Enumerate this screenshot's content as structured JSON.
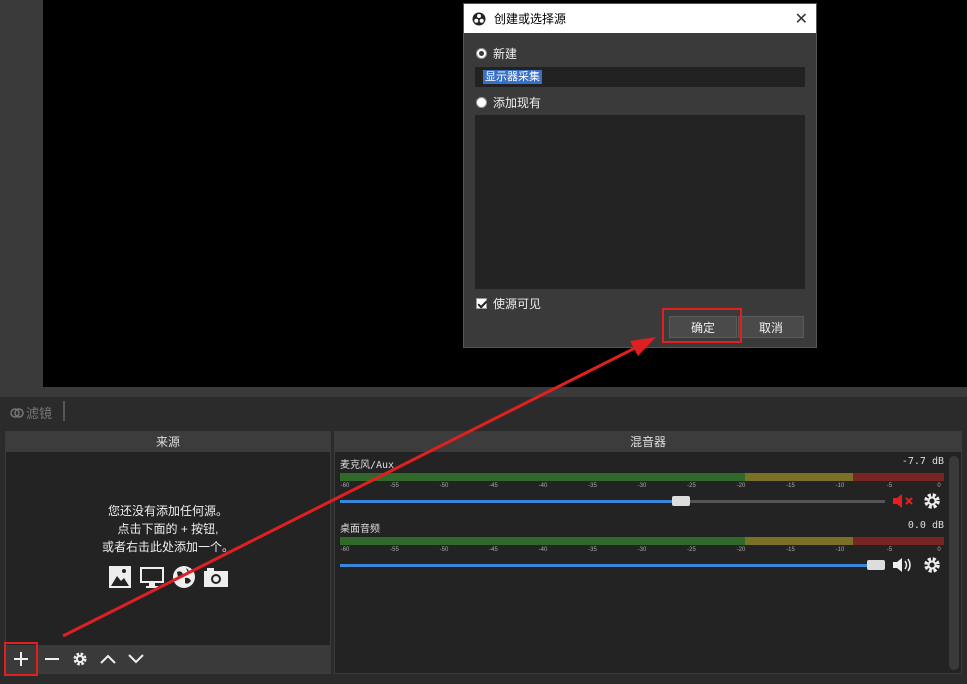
{
  "filters": {
    "label": "滤镜"
  },
  "sources": {
    "title": "来源",
    "empty_line1": "您还没有添加任何源。",
    "empty_line2": "点击下面的 + 按钮,",
    "empty_line3": "或者右击此处添加一个。",
    "toolbar": [
      "add",
      "remove",
      "properties",
      "move-up",
      "move-down"
    ]
  },
  "mixer": {
    "title": "混音器",
    "ticks": [
      "-60",
      "-55",
      "-50",
      "-45",
      "-40",
      "-35",
      "-30",
      "-25",
      "-20",
      "-15",
      "-10",
      "-5",
      "0"
    ],
    "channels": [
      {
        "name": "麦克风/Aux",
        "level": "-7.7 dB",
        "volume": 0.63,
        "muted": true
      },
      {
        "name": "桌面音频",
        "level": "0.0 dB",
        "volume": 1.0,
        "muted": false
      }
    ]
  },
  "dialog": {
    "title": "创建或选择源",
    "option_new": "新建",
    "name_value": "显示器采集",
    "option_existing": "添加现有",
    "visible_label": "使源可见",
    "ok_label": "确定",
    "cancel_label": "取消"
  },
  "colors": {
    "highlight": "#e02020",
    "accent": "#3a86d8"
  }
}
